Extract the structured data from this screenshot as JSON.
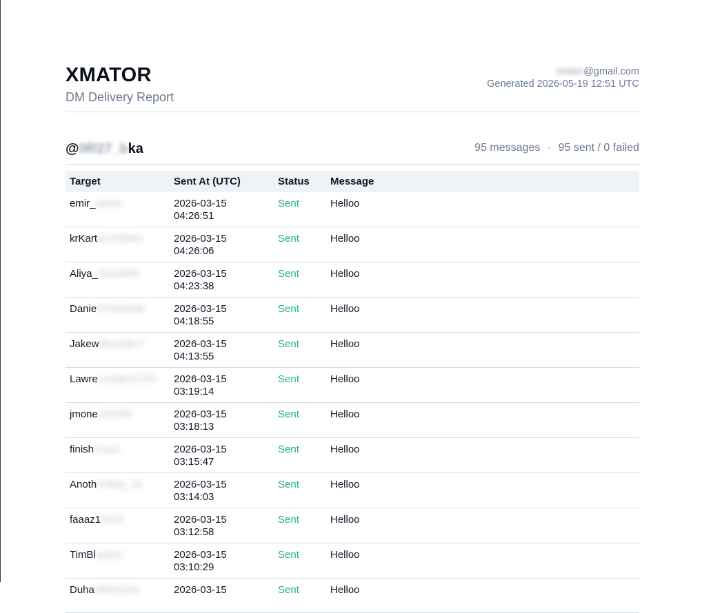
{
  "header": {
    "brand": "XMATOR",
    "subtitle": "DM Delivery Report",
    "email_blurred": "testes",
    "email_domain": "@gmail.com",
    "generated": "Generated 2026-05-19 12:51 UTC"
  },
  "account": {
    "handle_prefix": "@",
    "handle_blurred": "0R27_b",
    "handle_suffix": "ka",
    "messages": "95 messages",
    "separator": "·",
    "sent_failed": "95 sent / 0 failed"
  },
  "table": {
    "columns": [
      "Target",
      "Sent At (UTC)",
      "Status",
      "Message"
    ],
    "rows": [
      {
        "target": "emir_",
        "target_blur": "pdwin",
        "date": "2026-03-15",
        "time": "04:26:51",
        "status": "Sent",
        "message": "Helloo"
      },
      {
        "target": "krKart",
        "target_blur": "a1729941",
        "date": "2026-03-15",
        "time": "04:26:06",
        "status": "Sent",
        "message": "Helloo"
      },
      {
        "target": "Aliya_",
        "target_blur": "Yoo0999",
        "date": "2026-03-15",
        "time": "04:23:38",
        "status": "Sent",
        "message": "Helloo"
      },
      {
        "target": "Danie",
        "target_blur": "l7533445b",
        "date": "2026-03-15",
        "time": "04:18:55",
        "status": "Sent",
        "message": "Helloo"
      },
      {
        "target": "Jakew",
        "target_blur": "illounder7",
        "date": "2026-03-15",
        "time": "04:13:55",
        "status": "Sent",
        "message": "Helloo"
      },
      {
        "target": "Lawre",
        "target_blur": "nceBe21794",
        "date": "2026-03-15",
        "time": "03:19:14",
        "status": "Sent",
        "message": "Helloo"
      },
      {
        "target": "jmone",
        "target_blur": "y22336",
        "date": "2026-03-15",
        "time": "03:18:13",
        "status": "Sent",
        "message": "Helloo"
      },
      {
        "target": "finish",
        "target_blur": "ersee",
        "date": "2026-03-15",
        "time": "03:15:47",
        "status": "Sent",
        "message": "Helloo"
      },
      {
        "target": "Anoth",
        "target_blur": "erWay_11",
        "date": "2026-03-15",
        "time": "03:14:03",
        "status": "Sent",
        "message": "Helloo"
      },
      {
        "target": "faaaz1",
        "target_blur": "8322",
        "date": "2026-03-15",
        "time": "03:12:58",
        "status": "Sent",
        "message": "Helloo"
      },
      {
        "target": "TimBl",
        "target_blur": "ackes",
        "date": "2026-03-15",
        "time": "03:10:29",
        "status": "Sent",
        "message": "Helloo"
      },
      {
        "target": "Duha",
        "target_blur": "06931118",
        "date": "2026-03-15",
        "time": "",
        "status": "Sent",
        "message": "Helloo"
      }
    ]
  }
}
